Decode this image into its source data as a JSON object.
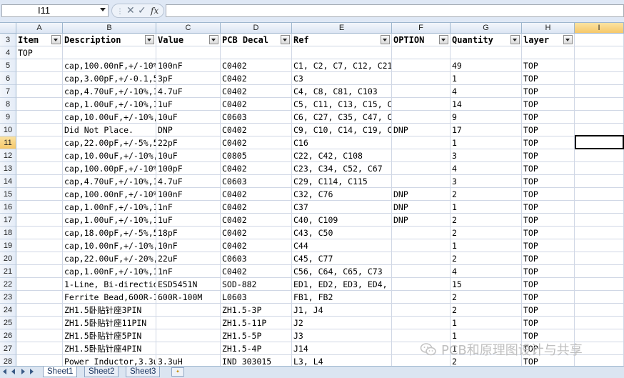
{
  "formula_bar": {
    "name_box": "I11",
    "fx_label": "fx",
    "content": ""
  },
  "columns": [
    "A",
    "B",
    "C",
    "D",
    "E",
    "F",
    "G",
    "H",
    "I"
  ],
  "selected_column": "I",
  "selected_row": "11",
  "header_row": {
    "row": "3",
    "cells": [
      "Item",
      "Description",
      "Value",
      "PCB Decal",
      "Ref",
      "OPTION",
      "Quantity",
      "layer"
    ]
  },
  "rows": [
    {
      "row": "4",
      "cells": [
        "TOP",
        "",
        "",
        "",
        "",
        "",
        "",
        ""
      ]
    },
    {
      "row": "5",
      "cells": [
        "",
        "cap,100.00nF,+/-10%",
        "100nF",
        "C0402",
        "C1, C2, C7, C12, C21, C24, C30, C",
        "",
        "49",
        "TOP"
      ]
    },
    {
      "row": "6",
      "cells": [
        "",
        "cap,3.00pF,+/-0.1,5",
        "3pF",
        "C0402",
        "C3",
        "",
        "1",
        "TOP"
      ]
    },
    {
      "row": "7",
      "cells": [
        "",
        "cap,4.70uF,+/-10%,1",
        "4.7uF",
        "C0402",
        "C4, C8, C81, C103",
        "",
        "4",
        "TOP"
      ]
    },
    {
      "row": "8",
      "cells": [
        "",
        "cap,1.00uF,+/-10%,1",
        "1uF",
        "C0402",
        "C5, C11, C13, C15, C17, C18, C36",
        "",
        "14",
        "TOP"
      ]
    },
    {
      "row": "9",
      "cells": [
        "",
        "cap,10.00uF,+/-10%,",
        "10uF",
        "C0603",
        "C6, C27, C35, C47, C54, C57, C59",
        "",
        "9",
        "TOP"
      ]
    },
    {
      "row": "10",
      "cells": [
        "",
        "Did Not Place.",
        "DNP",
        "C0402",
        "C9, C10, C14, C19, C",
        "DNP",
        "17",
        "TOP"
      ]
    },
    {
      "row": "11",
      "cells": [
        "",
        "cap,22.00pF,+/-5%,5",
        "22pF",
        "C0402",
        "C16",
        "",
        "1",
        "TOP"
      ]
    },
    {
      "row": "12",
      "cells": [
        "",
        "cap,10.00uF,+/-10%,",
        "10uF",
        "C0805",
        "C22, C42, C108",
        "",
        "3",
        "TOP"
      ]
    },
    {
      "row": "13",
      "cells": [
        "",
        "cap,100.00pF,+/-10%",
        "100pF",
        "C0402",
        "C23, C34, C52, C67",
        "",
        "4",
        "TOP"
      ]
    },
    {
      "row": "14",
      "cells": [
        "",
        "cap,4.70uF,+/-10%,1",
        "4.7uF",
        "C0603",
        "C29, C114, C115",
        "",
        "3",
        "TOP"
      ]
    },
    {
      "row": "15",
      "cells": [
        "",
        "cap,100.00nF,+/-10%",
        "100nF",
        "C0402",
        "C32, C76",
        "DNP",
        "2",
        "TOP"
      ]
    },
    {
      "row": "16",
      "cells": [
        "",
        "cap,1.00nF,+/-10%,1",
        "1nF",
        "C0402",
        "C37",
        "DNP",
        "1",
        "TOP"
      ]
    },
    {
      "row": "17",
      "cells": [
        "",
        "cap,1.00uF,+/-10%,1",
        "1uF",
        "C0402",
        "C40, C109",
        "DNP",
        "2",
        "TOP"
      ]
    },
    {
      "row": "18",
      "cells": [
        "",
        "cap,18.00pF,+/-5%,5",
        "18pF",
        "C0402",
        "C43, C50",
        "",
        "2",
        "TOP"
      ]
    },
    {
      "row": "19",
      "cells": [
        "",
        "cap,10.00nF,+/-10%,",
        "10nF",
        "C0402",
        "C44",
        "",
        "1",
        "TOP"
      ]
    },
    {
      "row": "20",
      "cells": [
        "",
        "cap,22.00uF,+/-20%,",
        "22uF",
        "C0603",
        "C45, C77",
        "",
        "2",
        "TOP"
      ]
    },
    {
      "row": "21",
      "cells": [
        "",
        "cap,1.00nF,+/-10%,1",
        "1nF",
        "C0402",
        "C56, C64, C65, C73",
        "",
        "4",
        "TOP"
      ]
    },
    {
      "row": "22",
      "cells": [
        "",
        "1-Line, Bi-directio",
        "ESD5451N",
        "SOD-882",
        "ED1, ED2, ED3, ED4, ED5, ED6, ED",
        "",
        "15",
        "TOP"
      ]
    },
    {
      "row": "23",
      "cells": [
        "",
        "Ferrite Bead,600R-1",
        "600R-100M",
        "L0603",
        "FB1, FB2",
        "",
        "2",
        "TOP"
      ]
    },
    {
      "row": "24",
      "cells": [
        "",
        "ZH1.5卧贴针座3PIN",
        "",
        "ZH1.5-3P",
        "J1, J4",
        "",
        "2",
        "TOP"
      ]
    },
    {
      "row": "25",
      "cells": [
        "",
        "ZH1.5卧贴针座11PIN",
        "",
        "ZH1.5-11P",
        "J2",
        "",
        "1",
        "TOP"
      ]
    },
    {
      "row": "26",
      "cells": [
        "",
        "ZH1.5卧贴针座5PIN",
        "",
        "ZH1.5-5P",
        "J3",
        "",
        "1",
        "TOP"
      ]
    },
    {
      "row": "27",
      "cells": [
        "",
        "ZH1.5卧贴针座4PIN",
        "",
        "ZH1.5-4P",
        "J14",
        "",
        "1",
        "TOP"
      ]
    },
    {
      "row": "28",
      "cells": [
        "",
        "Power Inductor,3.3u",
        "3.3uH",
        "IND 303015",
        "L3, L4",
        "",
        "2",
        "TOP"
      ]
    }
  ],
  "sheet_tabs": [
    "Sheet1",
    "Sheet2",
    "Sheet3"
  ],
  "active_sheet": "Sheet1",
  "watermark": "PCB和原理图设计与共享",
  "icons": {
    "nav_first": "first-sheet-icon",
    "nav_prev": "prev-sheet-icon",
    "nav_next": "next-sheet-icon",
    "nav_last": "last-sheet-icon",
    "insert_sheet": "insert-sheet-icon"
  }
}
